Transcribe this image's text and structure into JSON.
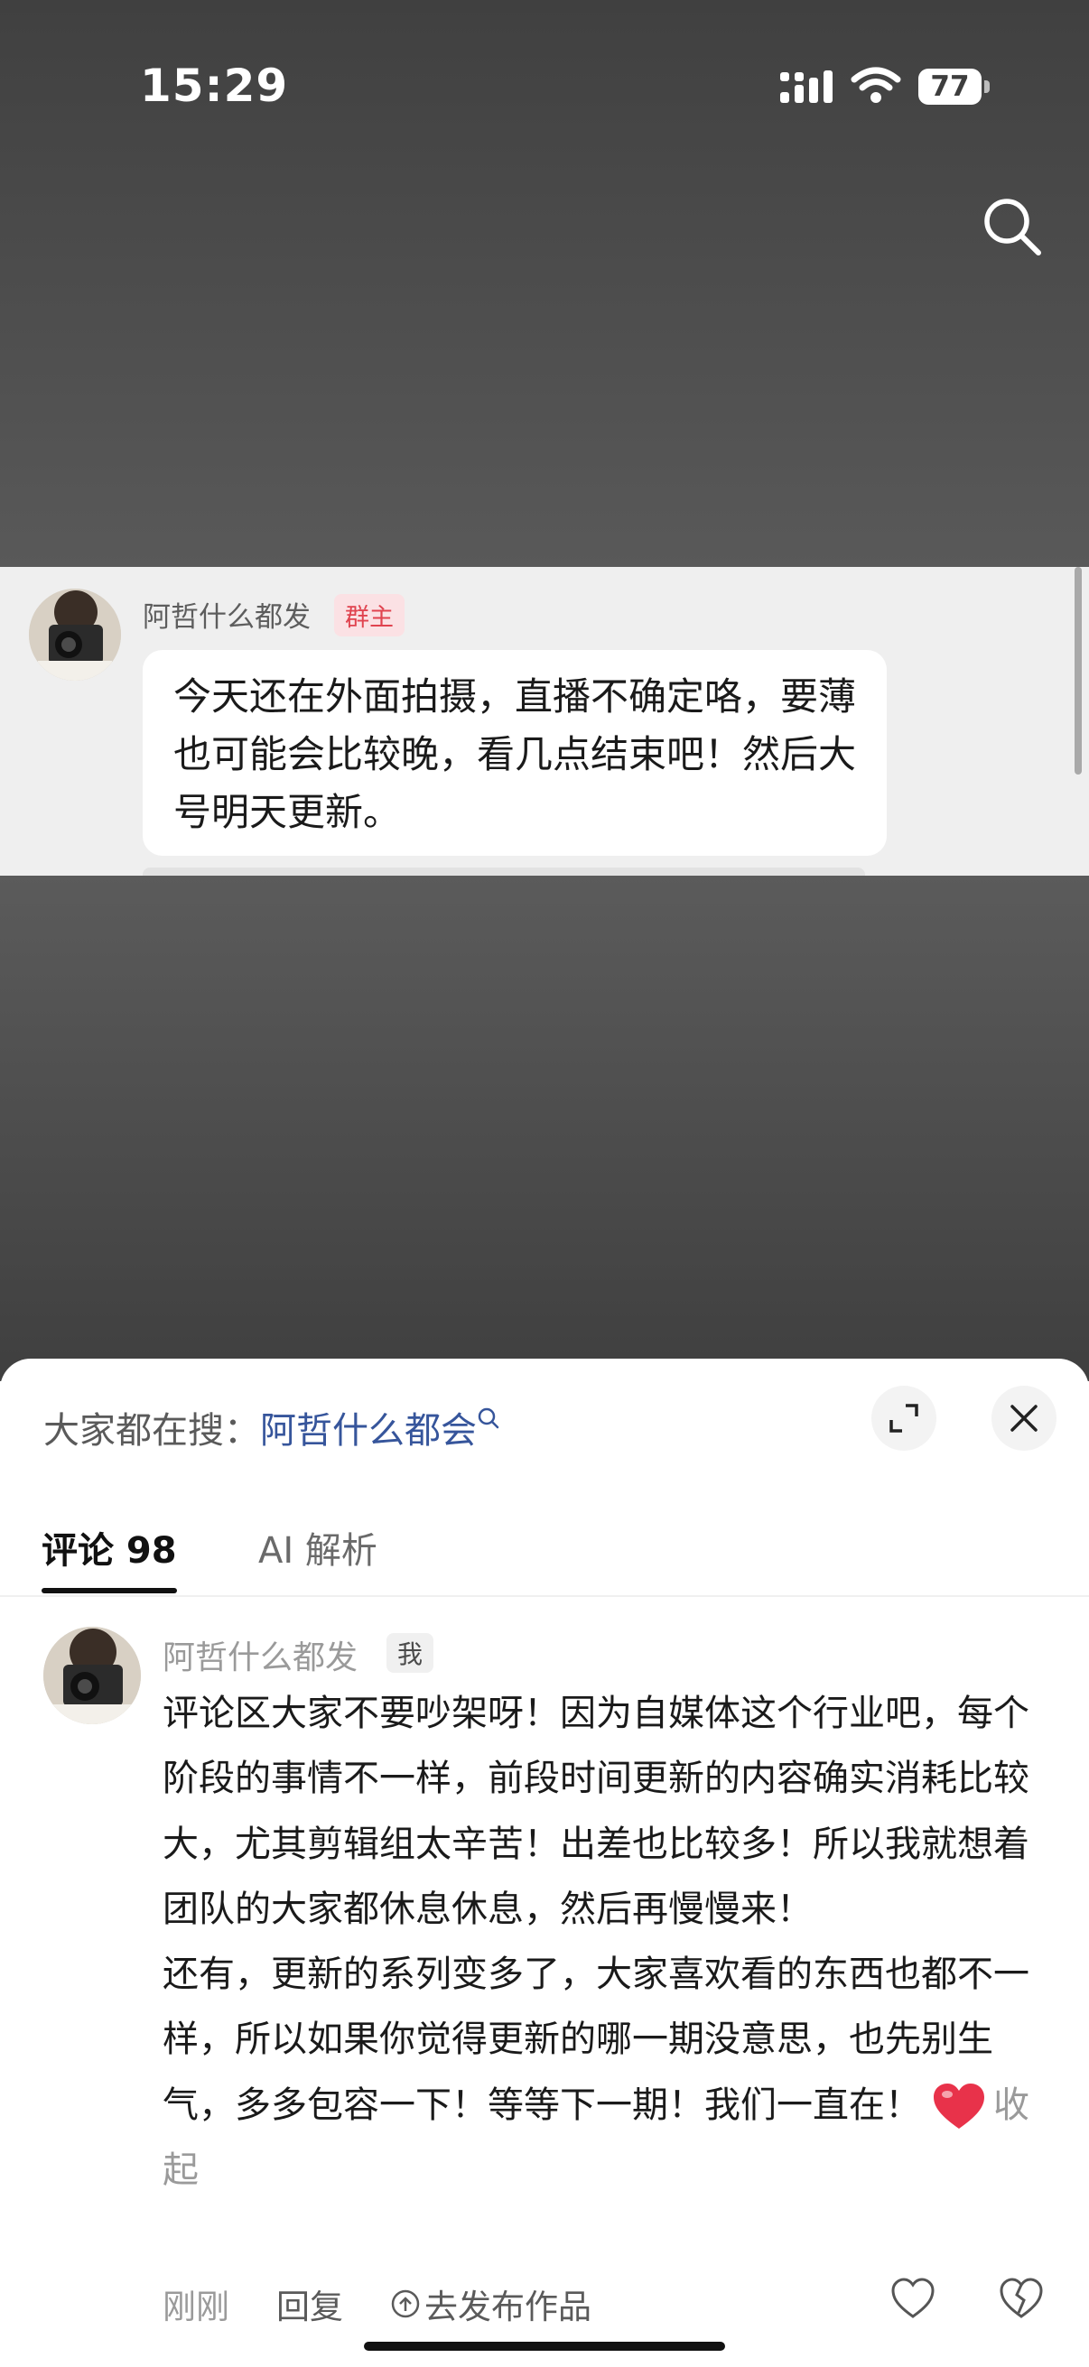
{
  "status_bar": {
    "time": "15:29",
    "battery": "77"
  },
  "group_chat": {
    "sender_name": "阿哲什么都发",
    "sender_badge": "群主",
    "message": "今天还在外面拍摄，直播不确定咯，要薄也可能会比较晚，看几点结束吧！然后大号明天更新。"
  },
  "comment_sheet": {
    "hot_search_label": "大家都在搜：",
    "hot_search_keyword": "阿哲什么都会",
    "tabs": [
      {
        "label": "评论 98",
        "active": true
      },
      {
        "label": "AI 解析",
        "active": false
      }
    ],
    "comment": {
      "author": "阿哲什么都发",
      "author_badge": "我",
      "paragraph1": "评论区大家不要吵架呀！因为自媒体这个行业吧，每个阶段的事情不一样，前段时间更新的内容确实消耗比较大，尤其剪辑组太辛苦！出差也比较多！所以我就想着团队的大家都休息休息，然后再慢慢来！",
      "paragraph2": "还有，更新的系列变多了，大家喜欢看的东西也都不一样，所以如果你觉得更新的哪一期没意思，也先别生气，多多包容一下！等等下一期！我们一直在！",
      "collapse_label": "收起",
      "time": "刚刚",
      "reply_label": "回复",
      "publish_label": "去发布作品"
    }
  },
  "colors": {
    "keyword": "#36559b",
    "badge_red": "#e0434f",
    "heart": "#e8324a"
  }
}
